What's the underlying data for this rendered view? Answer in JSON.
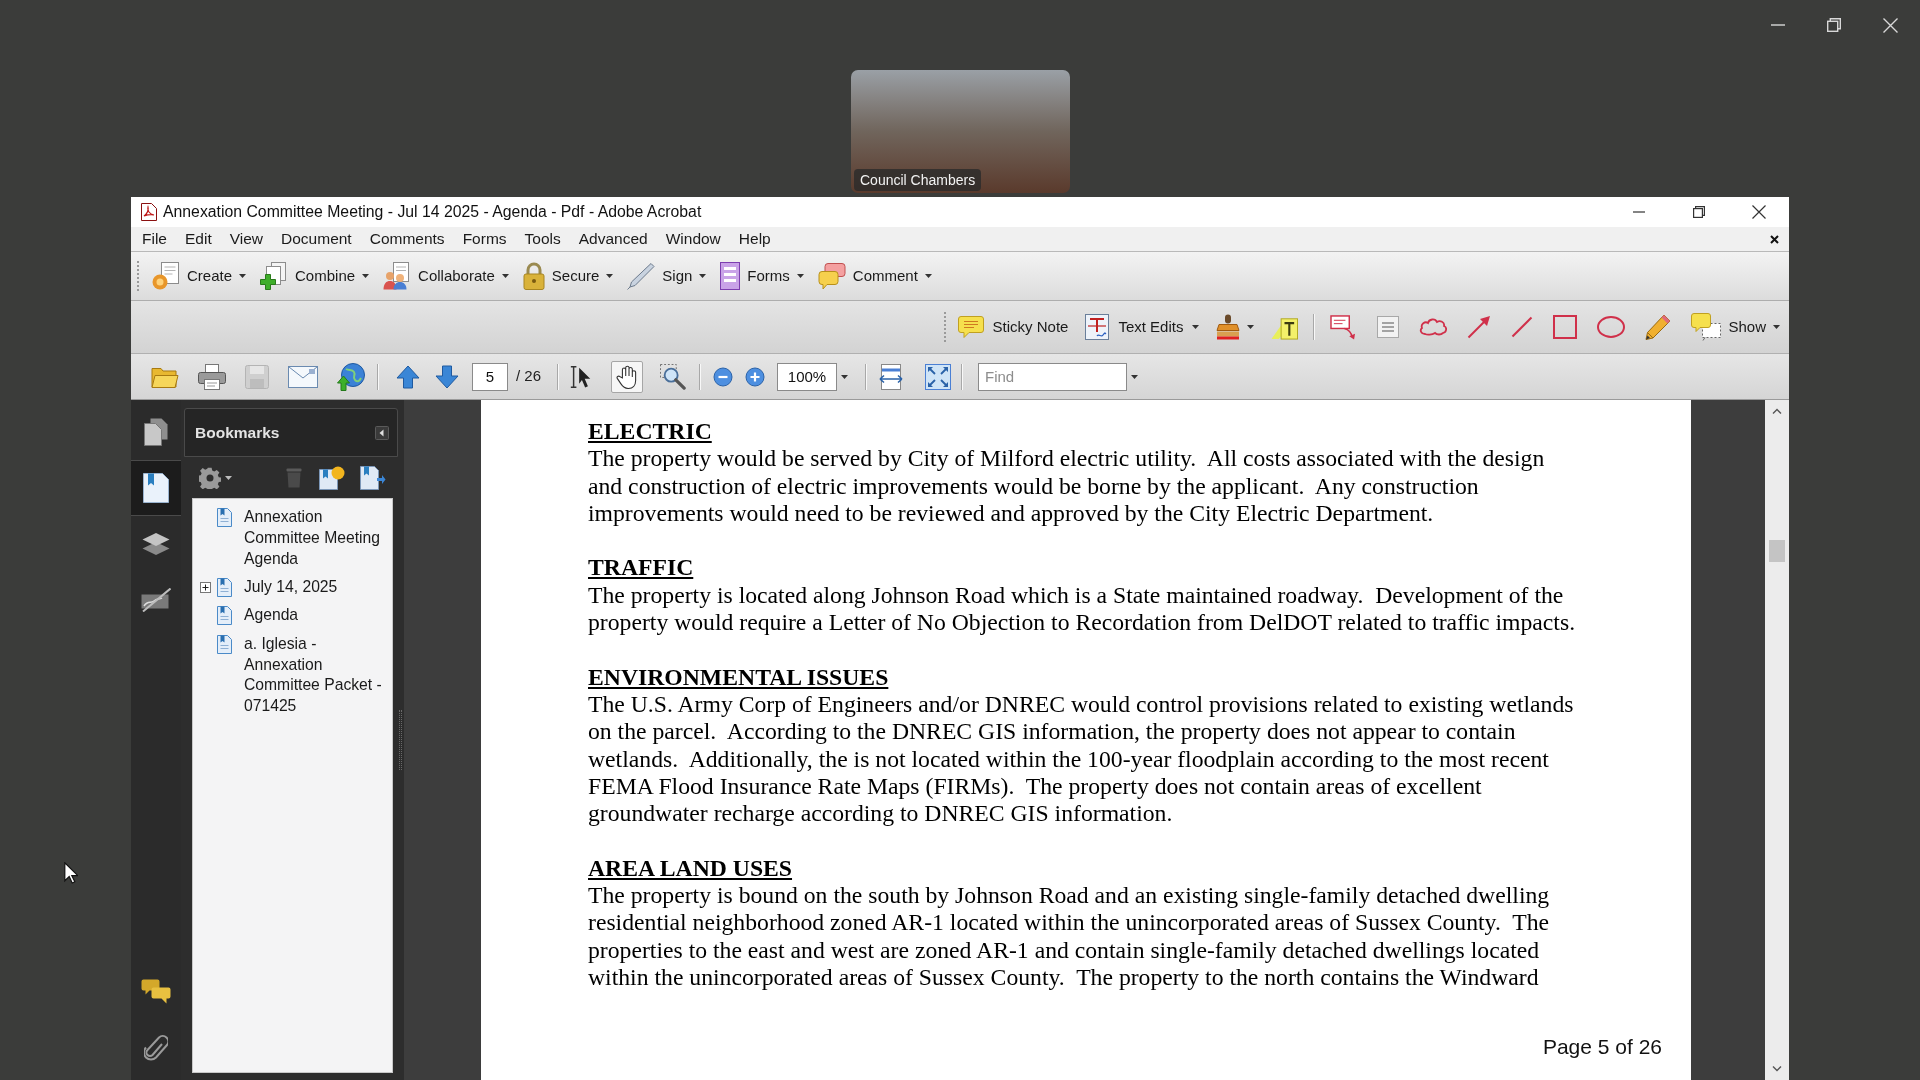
{
  "desktop": {
    "video_tile": {
      "label": "Council Chambers"
    }
  },
  "window": {
    "title": "Annexation Committee Meeting - Jul 14 2025 - Agenda - Pdf - Adobe Acrobat"
  },
  "menu_bar": [
    "File",
    "Edit",
    "View",
    "Document",
    "Comments",
    "Forms",
    "Tools",
    "Advanced",
    "Window",
    "Help"
  ],
  "task_toolbar": [
    {
      "kind": "create",
      "label": "Create"
    },
    {
      "kind": "combine",
      "label": "Combine"
    },
    {
      "kind": "collaborate",
      "label": "Collaborate"
    },
    {
      "kind": "secure",
      "label": "Secure"
    },
    {
      "kind": "sign",
      "label": "Sign"
    },
    {
      "kind": "forms",
      "label": "Forms"
    },
    {
      "kind": "comment",
      "label": "Comment"
    }
  ],
  "comment_toolbar": {
    "buttons": [
      {
        "kind": "sticky-note",
        "label": "Sticky Note",
        "dropdown": false
      },
      {
        "kind": "text-edits",
        "label": "Text Edits",
        "dropdown": true
      }
    ],
    "show_button": {
      "label": "Show"
    }
  },
  "nav_toolbar": {
    "file_tools": [
      {
        "kind": "open",
        "disabled": false
      },
      {
        "kind": "print",
        "disabled": false
      },
      {
        "kind": "save",
        "disabled": true
      },
      {
        "kind": "email",
        "disabled": false
      },
      {
        "kind": "web",
        "disabled": false
      }
    ],
    "page": {
      "current": "5",
      "total": "/ 26"
    },
    "select_tools": [
      {
        "kind": "select",
        "selected": false
      },
      {
        "kind": "hand",
        "selected": true
      },
      {
        "kind": "marquee-zoom",
        "selected": false
      }
    ],
    "zoom": {
      "value": "100%"
    },
    "find": {
      "placeholder": "Find"
    }
  },
  "navigation_rail": [
    {
      "kind": "pages",
      "selected": false
    },
    {
      "kind": "bookmarks",
      "selected": true
    },
    {
      "kind": "layers",
      "selected": false
    },
    {
      "kind": "signatures",
      "selected": false
    }
  ],
  "bookmarks_panel": {
    "title": "Bookmarks",
    "items": [
      {
        "kind": "leaf",
        "title": "Annexation Committee Meeting Agenda"
      },
      {
        "kind": "branch",
        "title": "July 14, 2025",
        "expanded": false
      },
      {
        "kind": "leaf",
        "title": "Agenda"
      },
      {
        "kind": "leaf",
        "title": "a. Iglesia - Annexation Committee Packet - 071425"
      }
    ]
  },
  "document": {
    "sections": [
      {
        "heading": "ELECTRIC",
        "lines": [
          "The property would be served by City of Milford electric utility.  All costs associated with the design",
          "and construction of electric improvements would be borne by the applicant.  Any construction",
          "improvements would need to be reviewed and approved by the City Electric Department."
        ]
      },
      {
        "heading": "TRAFFIC",
        "lines": [
          "The property is located along Johnson Road which is a State maintained roadway.  Development of the",
          "property would require a Letter of No Objection to Recordation from DelDOT related to traffic impacts."
        ]
      },
      {
        "heading": "ENVIRONMENTAL ISSUES",
        "lines": [
          "The U.S. Army Corp of Engineers and/or DNREC would control provisions related to existing wetlands",
          "on the parcel.  According to the DNREC GIS information, the property does not appear to contain",
          "wetlands.  Additionally, the is not located within the 100-year floodplain according to the most recent",
          "FEMA Flood Insurance Rate Maps (FIRMs).  The property does not contain areas of excellent",
          "groundwater recharge according to DNREC GIS information."
        ]
      },
      {
        "heading": "AREA LAND USES",
        "lines": [
          "The property is bound on the south by Johnson Road and an existing single-family detached dwelling",
          "residential neighborhood zoned AR-1 located within the unincorporated areas of Sussex County.  The",
          "properties to the east and west are zoned AR-1 and contain single-family detached dwellings located",
          "within the unincorporated areas of Sussex County.  The property to the north contains the Windward"
        ]
      }
    ],
    "page_label": "Page 5 of 26"
  }
}
